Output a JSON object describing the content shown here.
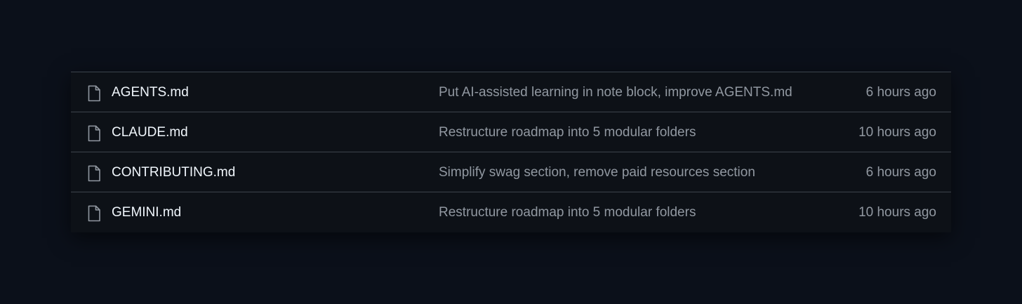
{
  "colors": {
    "page_background": "#0b101a",
    "table_background": "#0d1117",
    "divider": "#3d444d",
    "file_name_text": "#f0f6fc",
    "muted_text": "#9198a1"
  },
  "files": [
    {
      "icon": "file-icon",
      "name": "AGENTS.md",
      "commit_message": "Put AI-assisted learning in note block, improve AGENTS.md",
      "time": "6 hours ago"
    },
    {
      "icon": "file-icon",
      "name": "CLAUDE.md",
      "commit_message": "Restructure roadmap into 5 modular folders",
      "time": "10 hours ago"
    },
    {
      "icon": "file-icon",
      "name": "CONTRIBUTING.md",
      "commit_message": "Simplify swag section, remove paid resources section",
      "time": "6 hours ago"
    },
    {
      "icon": "file-icon",
      "name": "GEMINI.md",
      "commit_message": "Restructure roadmap into 5 modular folders",
      "time": "10 hours ago"
    }
  ]
}
